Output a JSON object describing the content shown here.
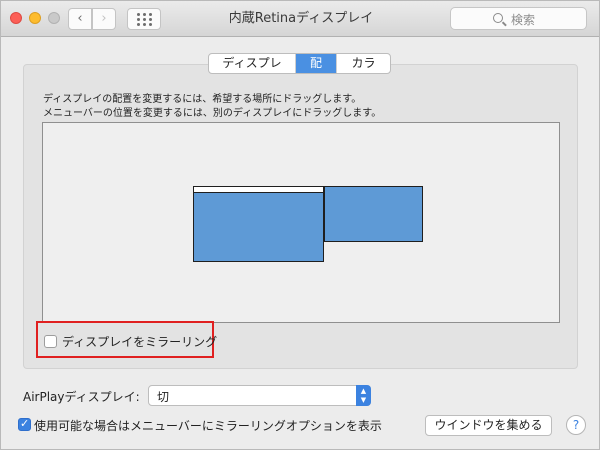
{
  "window": {
    "title": "内蔵Retinaディスプレイ"
  },
  "toolbar": {
    "back_icon": "‹",
    "forward_icon": "›",
    "search_placeholder": "検索"
  },
  "tabs": [
    {
      "label": "ディスプレイ",
      "selected": false
    },
    {
      "label": "配置",
      "selected": true
    },
    {
      "label": "カラー",
      "selected": false
    }
  ],
  "arrangement": {
    "instruction_line1": "ディスプレイの配置を変更するには、希望する場所にドラッグします。",
    "instruction_line2": "メニューバーの位置を変更するには、別のディスプレイにドラッグします。"
  },
  "mirroring": {
    "label": "ディスプレイをミラーリング",
    "checked": false
  },
  "airplay": {
    "label": "AirPlayディスプレイ:",
    "value": "切"
  },
  "menubar_option": {
    "label": "使用可能な場合はメニューバーにミラーリングオプションを表示",
    "checked": true
  },
  "buttons": {
    "gather_windows": "ウインドウを集める",
    "help": "?"
  },
  "colors": {
    "accent": "#3b82e0",
    "display_fill": "#5e9ad6",
    "highlight": "#e02020"
  }
}
